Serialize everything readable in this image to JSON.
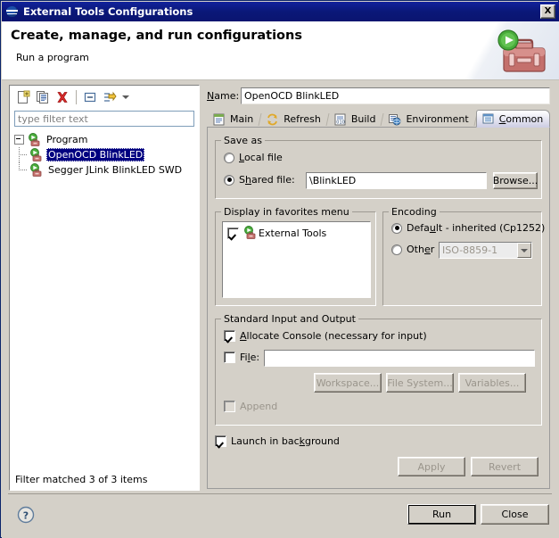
{
  "window": {
    "title": "External Tools Configurations",
    "title_icon": "eclipse-globe-icon",
    "close_label": "X"
  },
  "header": {
    "title": "Create, manage, and run configurations",
    "subtitle": "Run a program",
    "icon": "toolbox-with-run-arrow-icon"
  },
  "left": {
    "toolbar": [
      {
        "name": "new-configuration-button",
        "label": "New"
      },
      {
        "name": "duplicate-configuration-button",
        "label": "Duplicate"
      },
      {
        "name": "delete-configuration-button",
        "label": "Delete"
      },
      {
        "name": "collapse-all-button",
        "label": "Collapse All"
      },
      {
        "name": "filter-button",
        "label": "Filter"
      },
      {
        "name": "filter-menu-arrow",
        "label": "Filter menu"
      }
    ],
    "filter": {
      "placeholder": "type filter text",
      "value": ""
    },
    "tree": {
      "root": {
        "label": "Program",
        "expanded": true
      },
      "children": [
        {
          "label": "OpenOCD BlinkLED",
          "selected": true
        },
        {
          "label": "Segger JLink BlinkLED SWD",
          "selected": false
        }
      ]
    },
    "status": "Filter matched 3 of 3 items"
  },
  "right": {
    "name_label": "Name:",
    "name_value": "OpenOCD BlinkLED",
    "tabs": [
      {
        "label": "Main",
        "icon": "main-document-icon",
        "active": false
      },
      {
        "label": "Refresh",
        "icon": "refresh-arrows-icon",
        "active": false
      },
      {
        "label": "Build",
        "icon": "build-binary-icon",
        "active": false
      },
      {
        "label": "Environment",
        "icon": "environment-variables-icon",
        "active": false
      },
      {
        "label": "Common",
        "icon": "common-table-icon",
        "active": true
      }
    ],
    "save_as": {
      "group_label": "Save as",
      "local_file": {
        "label": "Local file",
        "checked": false
      },
      "shared_file": {
        "label": "Shared file:",
        "checked": true
      },
      "shared_path": "\\BlinkLED",
      "browse_label": "Browse..."
    },
    "favorites": {
      "group_label": "Display in favorites menu",
      "items": [
        {
          "label": "External Tools",
          "checked": true,
          "icon": "external-tools-icon"
        }
      ]
    },
    "encoding": {
      "group_label": "Encoding",
      "default": {
        "label": "Default - inherited (Cp1252)",
        "checked": true
      },
      "other": {
        "label": "Other",
        "checked": false
      },
      "other_value": "ISO-8859-1"
    },
    "stdio": {
      "group_label": "Standard Input and Output",
      "allocate_console": {
        "label": "Allocate Console (necessary for input)",
        "checked": true
      },
      "file": {
        "label": "File:",
        "checked": false,
        "value": ""
      },
      "workspace_label": "Workspace...",
      "file_system_label": "File System...",
      "variables_label": "Variables...",
      "append": {
        "label": "Append",
        "checked": false,
        "enabled": false
      }
    },
    "launch_in_background": {
      "label": "Launch in background",
      "checked": true
    },
    "apply_label": "Apply",
    "revert_label": "Revert"
  },
  "footer": {
    "help_icon": "help-question-icon",
    "run_label": "Run",
    "close_label": "Close"
  },
  "colors": {
    "title_bar": "#0a1878",
    "dialog_bg": "#d4d0c8",
    "selection": "#000080",
    "active_tab": "#cfcfe4",
    "accent_green": "#3d9b35",
    "accent_red": "#b9534f"
  }
}
